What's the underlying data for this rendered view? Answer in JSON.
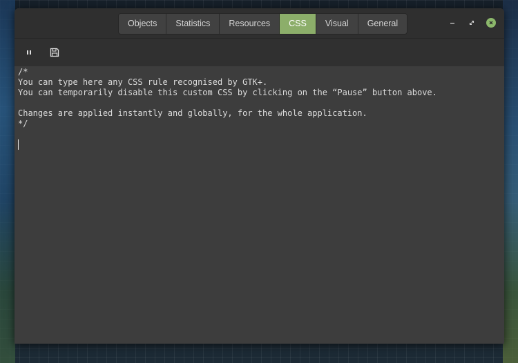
{
  "header": {
    "tabs": [
      {
        "label": "Objects"
      },
      {
        "label": "Statistics"
      },
      {
        "label": "Resources"
      },
      {
        "label": "CSS",
        "active": true
      },
      {
        "label": "Visual"
      },
      {
        "label": "General"
      }
    ],
    "window_controls": {
      "minimize_icon": "minimize-icon",
      "maximize_icon": "maximize-icon",
      "close_icon": "close-icon"
    }
  },
  "toolbar": {
    "pause_icon": "pause-icon",
    "save_icon": "save-icon"
  },
  "editor": {
    "lines": [
      "/*",
      "You can type here any CSS rule recognised by GTK+.",
      "You can temporarily disable this custom CSS by clicking on the “Pause” button above.",
      "",
      "Changes are applied instantly and globally, for the whole application.",
      "*/"
    ]
  },
  "colors": {
    "accent": "#8cae6a",
    "headerbar": "#2f2f2f",
    "editor_bg": "#3d3d3d",
    "text": "#dcdcdc"
  }
}
